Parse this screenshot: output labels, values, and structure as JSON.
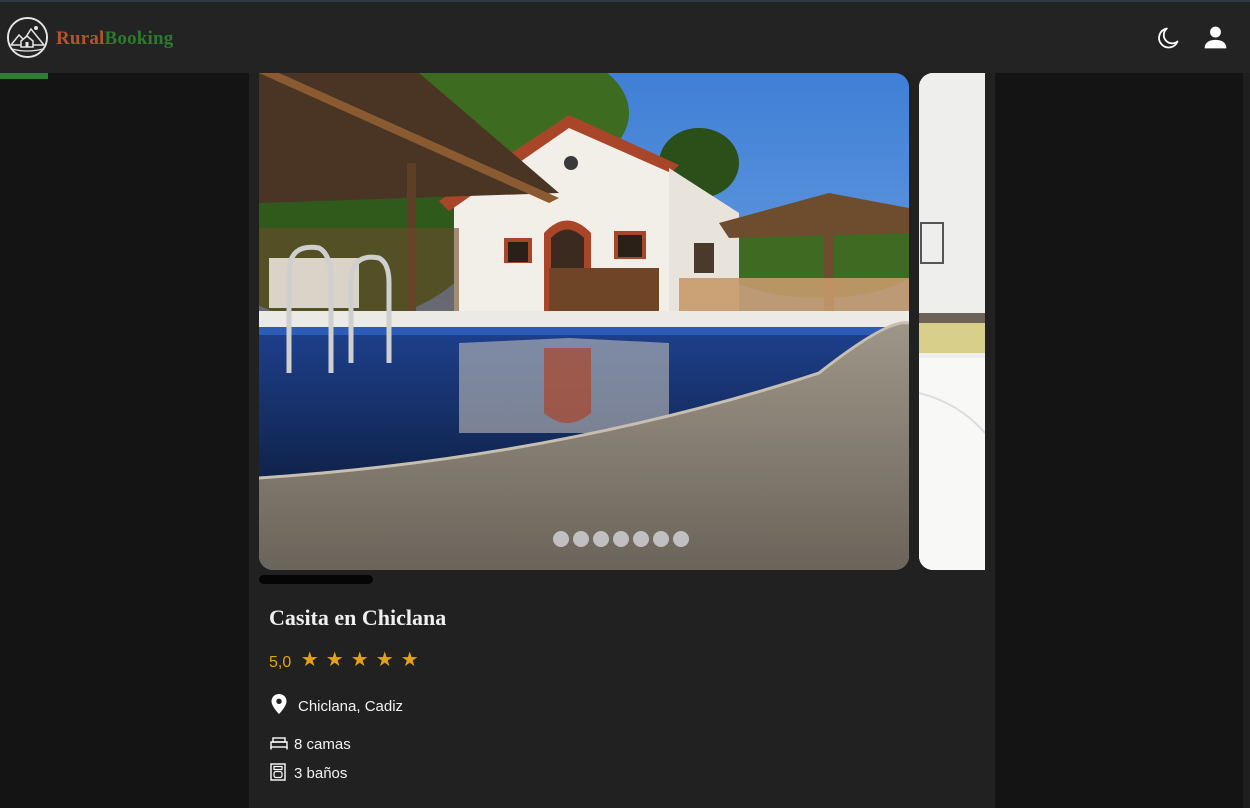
{
  "header": {
    "brand_part1": "Rural",
    "brand_part2": "Booking",
    "logo_icon": "house-mountain-logo-icon",
    "theme_icon": "moon-icon",
    "account_icon": "user-icon",
    "colors": {
      "brand_rural": "#b5532f",
      "brand_booking": "#2d7a2e",
      "accent_green": "#2e7d32"
    }
  },
  "listing": {
    "title": "Casita en Chiclana",
    "rating": "5,0",
    "stars_count": 5,
    "location": "Chiclana, Cadiz",
    "beds": "8 camas",
    "baths": "3 baños",
    "photos_count": 7,
    "colors": {
      "star": "#e3a21a"
    }
  }
}
